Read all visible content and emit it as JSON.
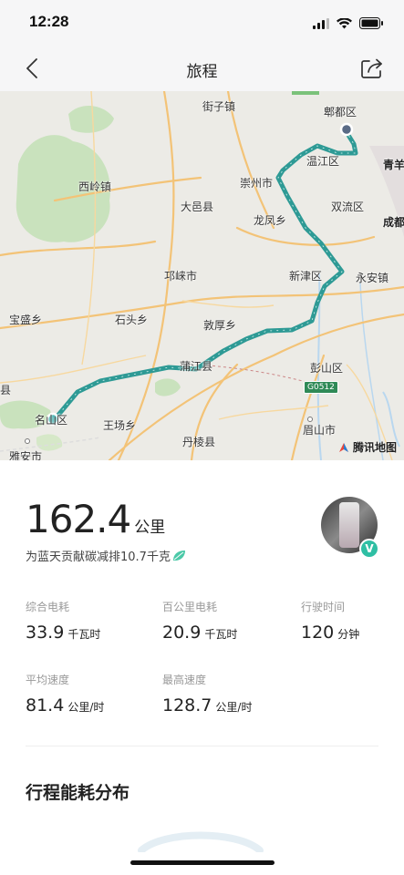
{
  "status_bar": {
    "time": "12:28"
  },
  "nav": {
    "title": "旅程"
  },
  "map": {
    "places": {
      "jiezi": "街子镇",
      "pidu": "郫都区",
      "xiling": "西岭镇",
      "wenjiang": "温江区",
      "qingyang": "青羊",
      "chongzhou": "崇州市",
      "dayi": "大邑县",
      "shuangliu": "双流区",
      "longfeng": "龙凤乡",
      "chengdu": "成都",
      "qionglai": "邛崃市",
      "xinjin": "新津区",
      "yongan": "永安镇",
      "baosheng": "宝盛乡",
      "shitou": "石头乡",
      "dunhou": "敦厚乡",
      "pengshan": "彭山区",
      "pujiang": "蒲江县",
      "mingshan": "名山区",
      "wangchang": "王场乡",
      "meishan": "眉山市",
      "danleng": "丹棱县",
      "yaan": "雅安市",
      "edge_county": "县"
    },
    "road_badge": "G0512",
    "attribution": "腾讯地图",
    "route_color": "#2e9a95"
  },
  "trip": {
    "distance_value": "162.4",
    "distance_unit": "公里",
    "carbon_text": "为蓝天贡献碳减排10.7千克"
  },
  "stats": [
    {
      "label": "综合电耗",
      "value": "33.9",
      "unit": "千瓦时"
    },
    {
      "label": "百公里电耗",
      "value": "20.9",
      "unit": "千瓦时"
    },
    {
      "label": "行驶时间",
      "value": "120",
      "unit": "分钟"
    },
    {
      "label": "平均速度",
      "value": "81.4",
      "unit": "公里/时"
    },
    {
      "label": "最高速度",
      "value": "128.7",
      "unit": "公里/时"
    }
  ],
  "avatar": {
    "badge": "V"
  },
  "section": {
    "title": "行程能耗分布"
  },
  "colors": {
    "accent": "#2fbfa4",
    "route": "#2e9a95",
    "leaf": "#4cc9a8"
  }
}
